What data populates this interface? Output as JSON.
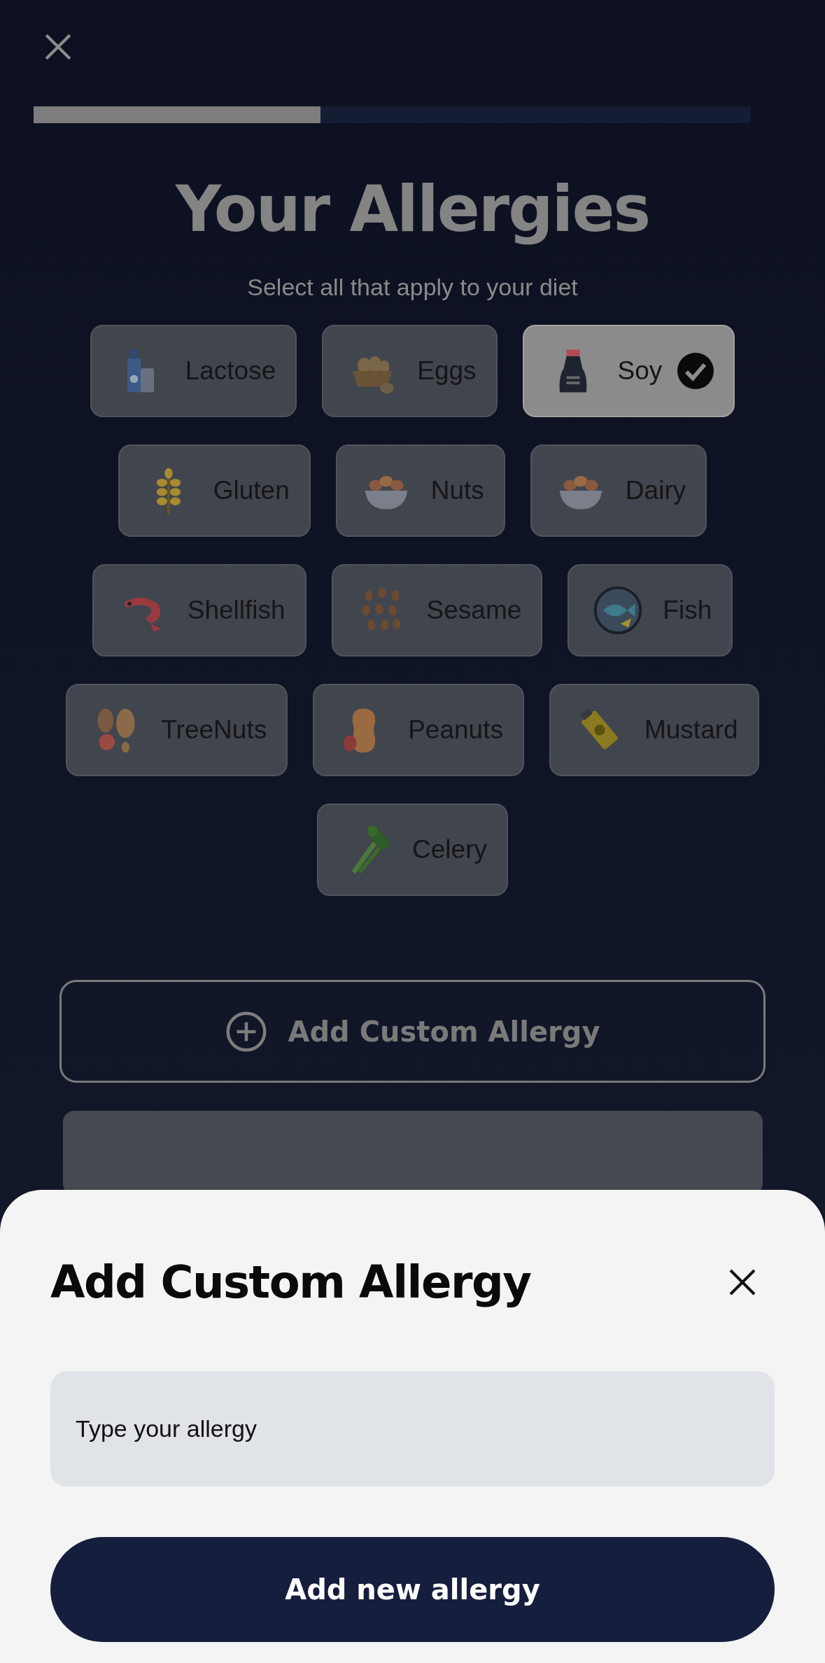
{
  "progress": {
    "level": 0.4
  },
  "title": "Your Allergies",
  "subtitle": "Select all that apply to your diet",
  "allergy_rows": [
    {
      "items": [
        {
          "label": "Lactose",
          "selected": false
        },
        {
          "label": "Eggs",
          "selected": false
        },
        {
          "label": "Soy",
          "selected": true
        }
      ]
    },
    {
      "items": [
        {
          "label": "Gluten",
          "selected": false
        },
        {
          "label": "Nuts",
          "selected": false
        },
        {
          "label": "Dairy",
          "selected": false
        }
      ]
    },
    {
      "items": [
        {
          "label": "Shellfish",
          "selected": false
        },
        {
          "label": "Sesame",
          "selected": false
        },
        {
          "label": "Fish",
          "selected": false
        }
      ]
    },
    {
      "items": [
        {
          "label": "TreeNuts",
          "selected": false
        },
        {
          "label": "Peanuts",
          "selected": false
        },
        {
          "label": "Mustard",
          "selected": false
        }
      ]
    },
    {
      "items": [
        {
          "label": "Celery",
          "selected": false
        }
      ]
    }
  ],
  "add_custom_button": {
    "label": "Add Custom Allergy"
  },
  "sheet": {
    "title": "Add Custom Allergy",
    "input": {
      "placeholder": "Type your allergy"
    },
    "submit_button": {
      "label": "Add new allergy"
    }
  }
}
